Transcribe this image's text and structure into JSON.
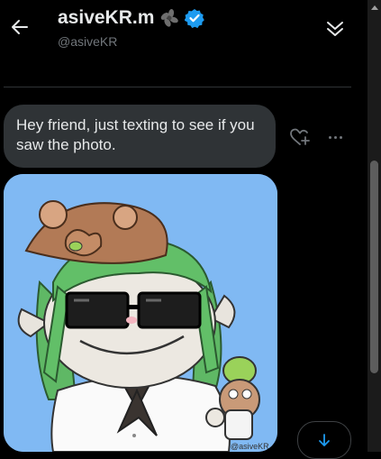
{
  "header": {
    "name": "asiveKR.m",
    "handle": "@asiveKR",
    "accent": "#1d9bf0"
  },
  "message": {
    "text": "Hey friend, just texting to see if you saw the photo."
  },
  "photo": {
    "watermark": "@asiveKR"
  },
  "icons": [
    "back-arrow-icon",
    "flower-emoji-icon",
    "verified-badge-icon",
    "chevron-double-down-icon",
    "heart-plus-icon",
    "more-dots-icon",
    "arrow-down-icon"
  ]
}
